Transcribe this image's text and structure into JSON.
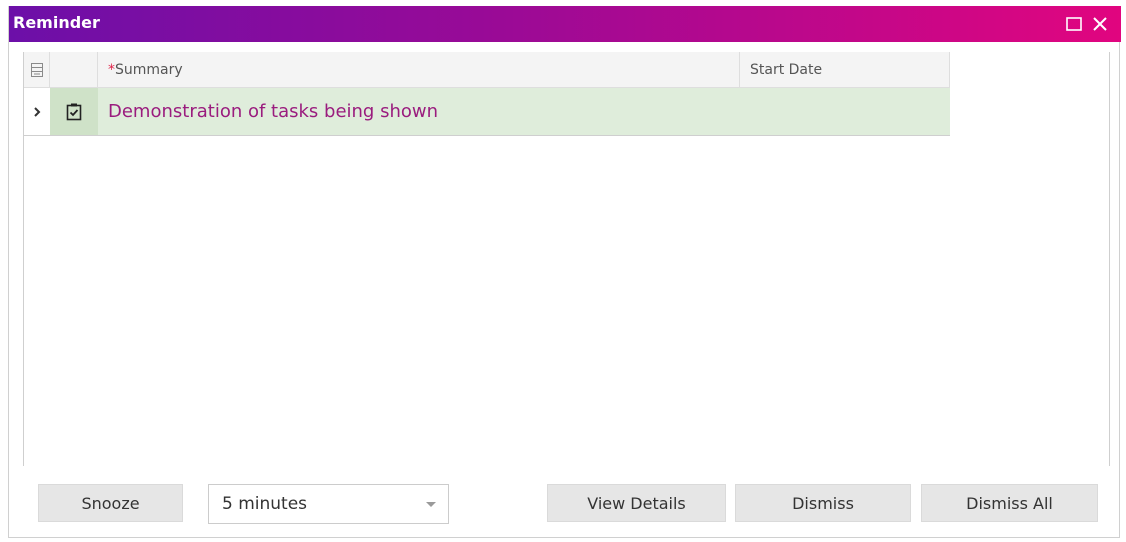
{
  "window": {
    "title": "Reminder"
  },
  "grid": {
    "columns": [
      {
        "key": "summary",
        "label": "Summary",
        "required_marker": "*"
      },
      {
        "key": "start_date",
        "label": "Start Date"
      }
    ],
    "rows": [
      {
        "type_icon": "task-checkbox-icon",
        "summary": "Demonstration of tasks being shown",
        "start_date": ""
      }
    ]
  },
  "footer": {
    "snooze_label": "Snooze",
    "snooze_interval_value": "5 minutes",
    "view_details_label": "View Details",
    "dismiss_label": "Dismiss",
    "dismiss_all_label": "Dismiss All"
  },
  "colors": {
    "title_gradient_start": "#6c0fa8",
    "title_gradient_end": "#e1057f",
    "row_highlight": "#dfeddb",
    "summary_text": "#9a1c7e",
    "required_marker": "#e0254a"
  }
}
